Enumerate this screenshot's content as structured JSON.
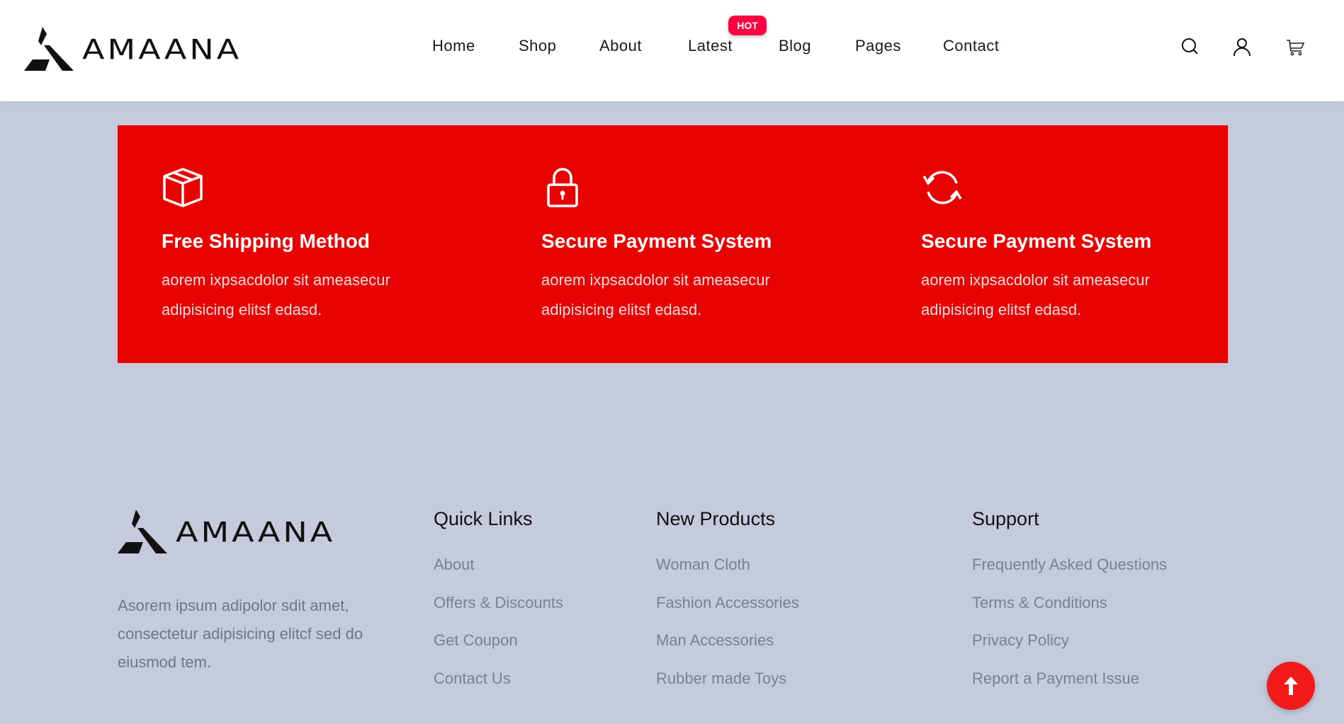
{
  "brand": {
    "name": "AMAANA"
  },
  "nav": {
    "items": [
      "Home",
      "Shop",
      "About",
      "Latest",
      "Blog",
      "Pages",
      "Contact"
    ],
    "hot_badge": "HOT"
  },
  "header_icons": [
    "search-icon",
    "user-icon",
    "cart-icon"
  ],
  "features": [
    {
      "icon": "box-icon",
      "title": "Free Shipping Method",
      "text": "aorem ixpsacdolor sit ameasecur adipisicing elitsf edasd."
    },
    {
      "icon": "lock-icon",
      "title": "Secure Payment System",
      "text": "aorem ixpsacdolor sit ameasecur adipisicing elitsf edasd."
    },
    {
      "icon": "refresh-icon",
      "title": "Secure Payment System",
      "text": "aorem ixpsacdolor sit ameasecur adipisicing elitsf edasd."
    }
  ],
  "footer": {
    "description": "Asorem ipsum adipolor sdit amet, consectetur adipisicing elitcf sed do eiusmod tem.",
    "quick_links": {
      "title": "Quick Links",
      "items": [
        "About",
        "Offers & Discounts",
        "Get Coupon",
        "Contact Us"
      ]
    },
    "new_products": {
      "title": "New Products",
      "items": [
        "Woman Cloth",
        "Fashion Accessories",
        "Man Accessories",
        "Rubber made Toys"
      ]
    },
    "support": {
      "title": "Support",
      "items": [
        "Frequently Asked Questions",
        "Terms & Conditions",
        "Privacy Policy",
        "Report a Payment Issue"
      ]
    }
  },
  "colors": {
    "accent": "#e90000",
    "hot": "#ff0040",
    "background": "#c5cbdd"
  }
}
